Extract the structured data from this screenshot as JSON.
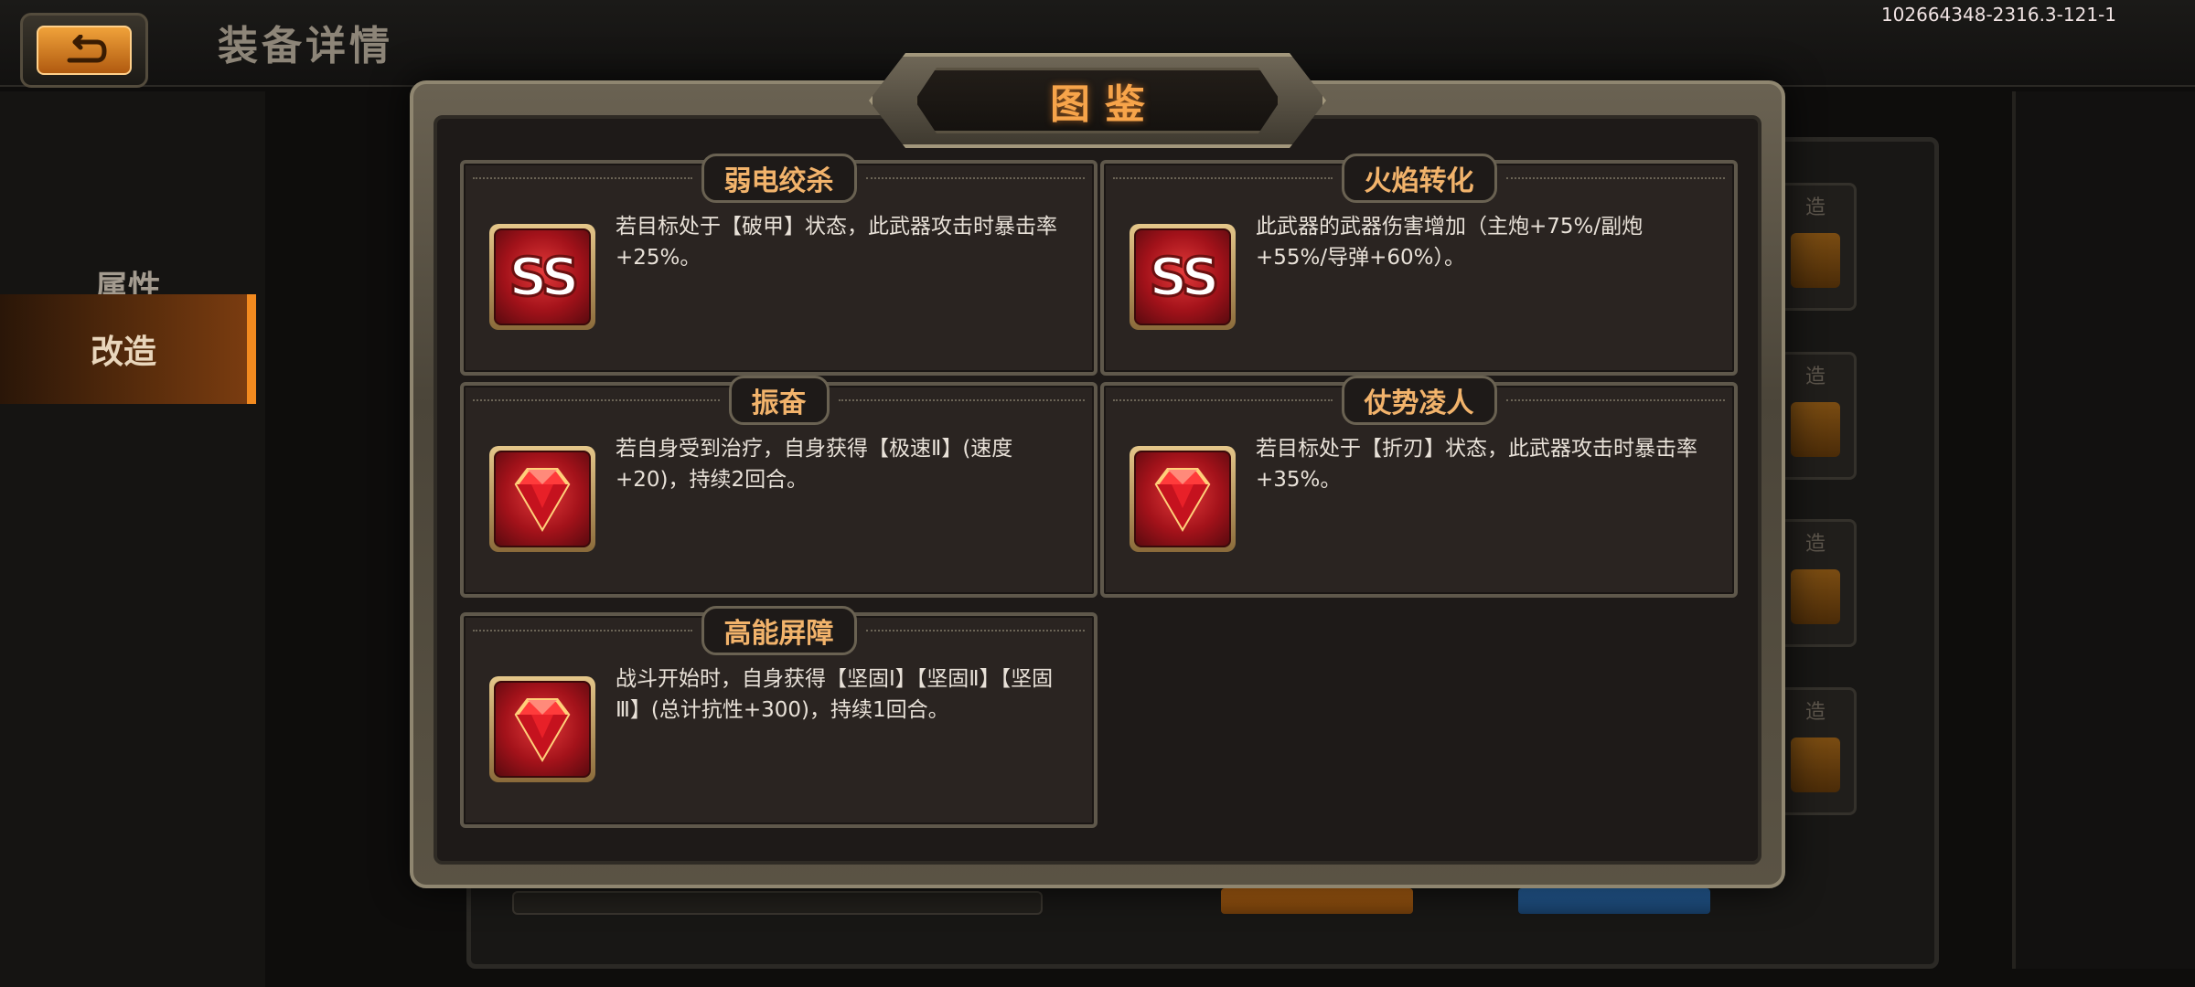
{
  "header": {
    "title": "装备详情",
    "build_id": "102664348-2316.3-121-1"
  },
  "nav": {
    "items": [
      {
        "label": "属性"
      },
      {
        "label": "改造"
      }
    ]
  },
  "background": {
    "slot_label": "造"
  },
  "modal": {
    "title": "图鉴",
    "cards": [
      {
        "title": "弱电绞杀",
        "icon": "ss-badge-icon",
        "desc": "若目标处于【破甲】状态，此武器攻击时暴击率+25%。"
      },
      {
        "title": "火焰转化",
        "icon": "ss-badge-icon",
        "desc": "此武器的武器伤害增加（主炮+75%/副炮+55%/导弹+60%）。"
      },
      {
        "title": "振奋",
        "icon": "ruby-gem-icon",
        "desc": "若自身受到治疗，自身获得【极速Ⅱ】(速度+20)，持续2回合。"
      },
      {
        "title": "仗势凌人",
        "icon": "ruby-gem-icon",
        "desc": "若目标处于【折刃】状态，此武器攻击时暴击率+35%。"
      },
      {
        "title": "高能屏障",
        "icon": "ruby-gem-icon",
        "desc": "战斗开始时，自身获得【坚固Ⅰ】【坚固Ⅱ】【坚固Ⅲ】(总计抗性+300)，持续1回合。"
      }
    ]
  },
  "colors": {
    "accent": "#f28a1f",
    "card_title": "#f2b36b",
    "badge_red": "#a3121a"
  }
}
